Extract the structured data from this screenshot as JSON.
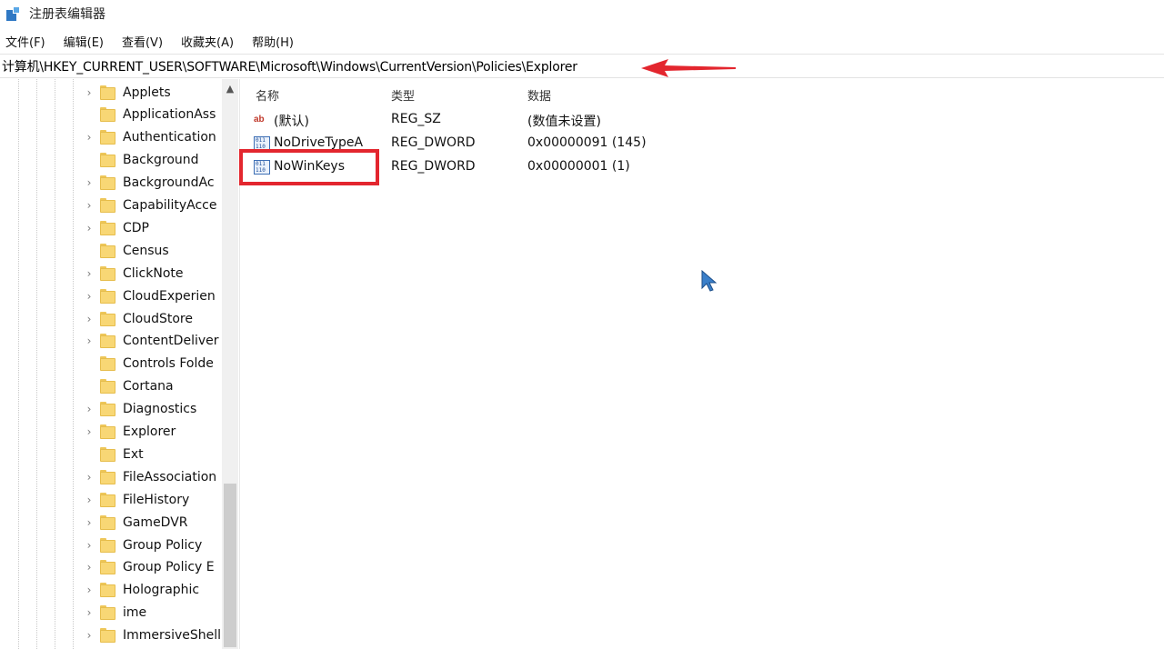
{
  "window": {
    "title": "注册表编辑器",
    "icon": "registry-editor-icon"
  },
  "menu": [
    "文件(F)",
    "编辑(E)",
    "查看(V)",
    "收藏夹(A)",
    "帮助(H)"
  ],
  "address": {
    "path": "计算机\\HKEY_CURRENT_USER\\SOFTWARE\\Microsoft\\Windows\\CurrentVersion\\Policies\\Explorer"
  },
  "tree": {
    "items": [
      {
        "label": "Applets",
        "expandable": true
      },
      {
        "label": "ApplicationAss",
        "expandable": false
      },
      {
        "label": "Authentication",
        "expandable": true
      },
      {
        "label": "Background",
        "expandable": false
      },
      {
        "label": "BackgroundAc",
        "expandable": true
      },
      {
        "label": "CapabilityAcce",
        "expandable": true
      },
      {
        "label": "CDP",
        "expandable": true
      },
      {
        "label": "Census",
        "expandable": false
      },
      {
        "label": "ClickNote",
        "expandable": true
      },
      {
        "label": "CloudExperien",
        "expandable": true
      },
      {
        "label": "CloudStore",
        "expandable": true
      },
      {
        "label": "ContentDeliver",
        "expandable": true
      },
      {
        "label": "Controls Folde",
        "expandable": false
      },
      {
        "label": "Cortana",
        "expandable": false
      },
      {
        "label": "Diagnostics",
        "expandable": true
      },
      {
        "label": "Explorer",
        "expandable": true
      },
      {
        "label": "Ext",
        "expandable": false
      },
      {
        "label": "FileAssociation",
        "expandable": true
      },
      {
        "label": "FileHistory",
        "expandable": true
      },
      {
        "label": "GameDVR",
        "expandable": true
      },
      {
        "label": "Group Policy",
        "expandable": true
      },
      {
        "label": "Group Policy E",
        "expandable": true
      },
      {
        "label": "Holographic",
        "expandable": true
      },
      {
        "label": "ime",
        "expandable": true
      },
      {
        "label": "ImmersiveShell",
        "expandable": true
      }
    ]
  },
  "values": {
    "headers": {
      "name": "名称",
      "type": "类型",
      "data": "数据"
    },
    "rows": [
      {
        "name": "(默认)",
        "type": "REG_SZ",
        "data": "(数值未设置)",
        "icon": "string-value-icon"
      },
      {
        "name": "NoDriveTypeA",
        "type": "REG_DWORD",
        "data": "0x00000091 (145)",
        "icon": "dword-value-icon"
      },
      {
        "name": "NoWinKeys",
        "type": "REG_DWORD",
        "data": "0x00000001 (1)",
        "icon": "dword-value-icon"
      }
    ]
  },
  "annotations": {
    "highlight_color": "#e3262e",
    "arrow_color": "#e3262e"
  }
}
